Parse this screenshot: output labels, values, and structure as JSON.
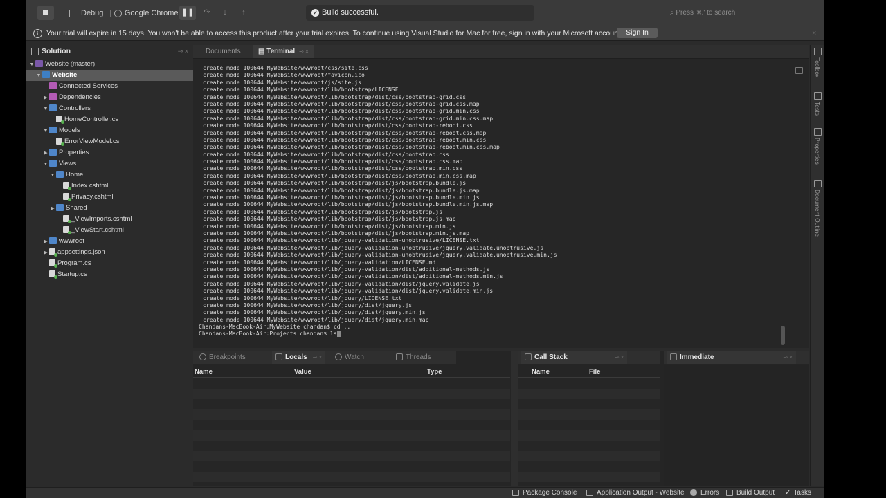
{
  "toolbar": {
    "configuration": "Debug",
    "target": "Google Chrome",
    "status_text": "Build successful.",
    "search_placeholder": "Press '⌘.' to search"
  },
  "trial_banner": {
    "message": "Your trial will expire in 15 days. You won't be able to access this product after your trial expires. To continue using Visual Studio for Mac for free, sign in with your Microsoft account.",
    "sign_in_label": "Sign In"
  },
  "solution": {
    "title": "Solution",
    "items": [
      {
        "label": "Website (master)",
        "icon": "solution-icon"
      },
      {
        "label": "Website",
        "icon": "project-icon"
      },
      {
        "label": "Connected Services",
        "icon": "services-icon"
      },
      {
        "label": "Dependencies",
        "icon": "dependencies-icon"
      },
      {
        "label": "Controllers",
        "icon": "folder-icon"
      },
      {
        "label": "HomeController.cs",
        "icon": "csharp-file-icon"
      },
      {
        "label": "Models",
        "icon": "folder-icon"
      },
      {
        "label": "ErrorViewModel.cs",
        "icon": "csharp-file-icon"
      },
      {
        "label": "Properties",
        "icon": "folder-icon"
      },
      {
        "label": "Views",
        "icon": "folder-icon"
      },
      {
        "label": "Home",
        "icon": "folder-icon"
      },
      {
        "label": "Index.cshtml",
        "icon": "razor-file-icon"
      },
      {
        "label": "Privacy.cshtml",
        "icon": "razor-file-icon"
      },
      {
        "label": "Shared",
        "icon": "folder-icon"
      },
      {
        "label": "_ViewImports.cshtml",
        "icon": "razor-file-icon"
      },
      {
        "label": "_ViewStart.cshtml",
        "icon": "razor-file-icon"
      },
      {
        "label": "wwwroot",
        "icon": "folder-icon"
      },
      {
        "label": "appsettings.json",
        "icon": "json-file-icon"
      },
      {
        "label": "Program.cs",
        "icon": "csharp-file-icon"
      },
      {
        "label": "Startup.cs",
        "icon": "csharp-file-icon"
      }
    ]
  },
  "doc_tabs": {
    "documents": "Documents",
    "terminal": "Terminal"
  },
  "terminal": {
    "lines": [
      "create mode 100644 MyWebsite/wwwroot/css/site.css",
      "create mode 100644 MyWebsite/wwwroot/favicon.ico",
      "create mode 100644 MyWebsite/wwwroot/js/site.js",
      "create mode 100644 MyWebsite/wwwroot/lib/bootstrap/LICENSE",
      "create mode 100644 MyWebsite/wwwroot/lib/bootstrap/dist/css/bootstrap-grid.css",
      "create mode 100644 MyWebsite/wwwroot/lib/bootstrap/dist/css/bootstrap-grid.css.map",
      "create mode 100644 MyWebsite/wwwroot/lib/bootstrap/dist/css/bootstrap-grid.min.css",
      "create mode 100644 MyWebsite/wwwroot/lib/bootstrap/dist/css/bootstrap-grid.min.css.map",
      "create mode 100644 MyWebsite/wwwroot/lib/bootstrap/dist/css/bootstrap-reboot.css",
      "create mode 100644 MyWebsite/wwwroot/lib/bootstrap/dist/css/bootstrap-reboot.css.map",
      "create mode 100644 MyWebsite/wwwroot/lib/bootstrap/dist/css/bootstrap-reboot.min.css",
      "create mode 100644 MyWebsite/wwwroot/lib/bootstrap/dist/css/bootstrap-reboot.min.css.map",
      "create mode 100644 MyWebsite/wwwroot/lib/bootstrap/dist/css/bootstrap.css",
      "create mode 100644 MyWebsite/wwwroot/lib/bootstrap/dist/css/bootstrap.css.map",
      "create mode 100644 MyWebsite/wwwroot/lib/bootstrap/dist/css/bootstrap.min.css",
      "create mode 100644 MyWebsite/wwwroot/lib/bootstrap/dist/css/bootstrap.min.css.map",
      "create mode 100644 MyWebsite/wwwroot/lib/bootstrap/dist/js/bootstrap.bundle.js",
      "create mode 100644 MyWebsite/wwwroot/lib/bootstrap/dist/js/bootstrap.bundle.js.map",
      "create mode 100644 MyWebsite/wwwroot/lib/bootstrap/dist/js/bootstrap.bundle.min.js",
      "create mode 100644 MyWebsite/wwwroot/lib/bootstrap/dist/js/bootstrap.bundle.min.js.map",
      "create mode 100644 MyWebsite/wwwroot/lib/bootstrap/dist/js/bootstrap.js",
      "create mode 100644 MyWebsite/wwwroot/lib/bootstrap/dist/js/bootstrap.js.map",
      "create mode 100644 MyWebsite/wwwroot/lib/bootstrap/dist/js/bootstrap.min.js",
      "create mode 100644 MyWebsite/wwwroot/lib/bootstrap/dist/js/bootstrap.min.js.map",
      "create mode 100644 MyWebsite/wwwroot/lib/jquery-validation-unobtrusive/LICENSE.txt",
      "create mode 100644 MyWebsite/wwwroot/lib/jquery-validation-unobtrusive/jquery.validate.unobtrusive.js",
      "create mode 100644 MyWebsite/wwwroot/lib/jquery-validation-unobtrusive/jquery.validate.unobtrusive.min.js",
      "create mode 100644 MyWebsite/wwwroot/lib/jquery-validation/LICENSE.md",
      "create mode 100644 MyWebsite/wwwroot/lib/jquery-validation/dist/additional-methods.js",
      "create mode 100644 MyWebsite/wwwroot/lib/jquery-validation/dist/additional-methods.min.js",
      "create mode 100644 MyWebsite/wwwroot/lib/jquery-validation/dist/jquery.validate.js",
      "create mode 100644 MyWebsite/wwwroot/lib/jquery-validation/dist/jquery.validate.min.js",
      "create mode 100644 MyWebsite/wwwroot/lib/jquery/LICENSE.txt",
      "create mode 100644 MyWebsite/wwwroot/lib/jquery/dist/jquery.js",
      "create mode 100644 MyWebsite/wwwroot/lib/jquery/dist/jquery.min.js",
      "create mode 100644 MyWebsite/wwwroot/lib/jquery/dist/jquery.min.map"
    ],
    "prompt_lines": [
      "Chandans-MacBook-Air:MyWebsite chandan$ cd ..",
      "Chandans-MacBook-Air:Projects chandan$ ls"
    ]
  },
  "debug_pads": {
    "tabs": {
      "breakpoints": "Breakpoints",
      "locals": "Locals",
      "watch": "Watch",
      "threads": "Threads",
      "call_stack": "Call Stack",
      "immediate": "Immediate"
    },
    "locals_columns": [
      "Name",
      "Value",
      "Type"
    ],
    "callstack_columns": [
      "Name",
      "File"
    ]
  },
  "rail": {
    "toolbox": "Toolbox",
    "tests": "Tests",
    "properties": "Properties",
    "document_outline": "Document Outline"
  },
  "statusbar": {
    "package_console": "Package Console",
    "application_output": "Application Output - Website",
    "errors": "Errors",
    "build_output": "Build Output",
    "tasks": "Tasks"
  }
}
